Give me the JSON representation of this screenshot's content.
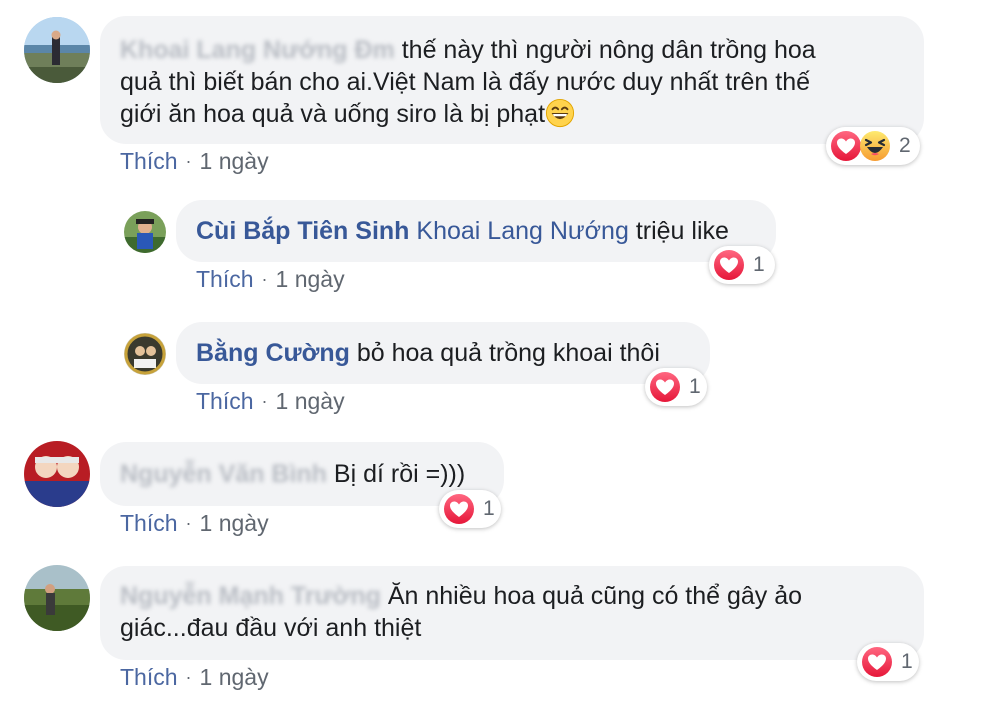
{
  "comments": [
    {
      "author": "Khoai Lang Nướng Đm",
      "text": "thế này thì người nông dân trồng hoa quả thì biết bán cho ai.Việt Nam là đấy nước duy nhất trên thế giới ăn hoa quả và uống siro là bị phạt",
      "line1": "thế này thì người nông dân trồng hoa",
      "line2": "quả thì biết bán cho ai.Việt Nam là đấy nước duy nhất trên thế",
      "line3": "giới ăn hoa quả và uống siro là bị phạt",
      "emoji": "grinning-face-icon",
      "like_label": "Thích",
      "time": "1 ngày",
      "reactions": [
        "love-icon",
        "laugh-icon"
      ],
      "reaction_count": "2"
    },
    {
      "author": "Cùi Bắp Tiên Sinh",
      "mention": "Khoai Lang Nướng",
      "text": "triệu like",
      "like_label": "Thích",
      "time": "1 ngày",
      "reactions": [
        "love-icon"
      ],
      "reaction_count": "1"
    },
    {
      "author": "Bằng Cường",
      "text": "bỏ hoa quả trồng khoai thôi",
      "like_label": "Thích",
      "time": "1 ngày",
      "reactions": [
        "love-icon"
      ],
      "reaction_count": "1"
    },
    {
      "author": "Nguyễn Văn Bình",
      "text": "Bị dí rồi =)))",
      "like_label": "Thích",
      "time": "1 ngày",
      "reactions": [
        "love-icon"
      ],
      "reaction_count": "1"
    },
    {
      "author": "Nguyễn Mạnh Trường",
      "text": "Ăn nhiều hoa quả cũng có thể gây ảo giác...đau đầu với anh thiệt",
      "line1": "Ăn nhiều hoa quả cũng có thể gây ảo",
      "line2": "giác...đau đầu với anh thiệt",
      "like_label": "Thích",
      "time": "1 ngày",
      "reactions": [
        "love-icon"
      ],
      "reaction_count": "1"
    }
  ],
  "colors": {
    "link": "#385898",
    "bubble": "#f2f3f5",
    "meta": "#606770",
    "love": "#f33e58",
    "haha": "#f7b125"
  }
}
